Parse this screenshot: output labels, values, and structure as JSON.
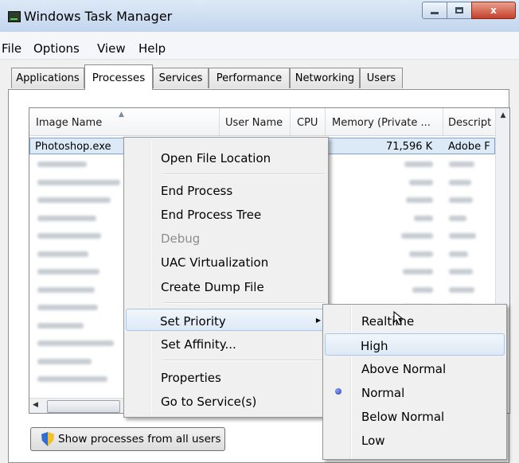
{
  "window": {
    "title": "Windows Task Manager"
  },
  "caption_buttons": {
    "minimize": "minimize-icon",
    "maximize": "maximize-icon",
    "close": "x"
  },
  "menubar": {
    "items": [
      "File",
      "Options",
      "View",
      "Help"
    ]
  },
  "tabs": [
    "Applications",
    "Processes",
    "Services",
    "Performance",
    "Networking",
    "Users"
  ],
  "active_tab": "Processes",
  "process_table": {
    "columns": [
      "Image Name",
      "User Name",
      "CPU",
      "Memory (Private ...",
      "Descript"
    ],
    "selected_row": {
      "image_name": "Photoshop.exe",
      "memory": "71,596 K",
      "description": "Adobe F"
    }
  },
  "show_all_button": {
    "label": "Show processes from all users",
    "icon": "uac-shield-icon"
  },
  "context_menu": {
    "items": [
      "Open File Location",
      "End Process",
      "End Process Tree",
      "Debug",
      "UAC Virtualization",
      "Create Dump File",
      "Set Priority",
      "Set Affinity...",
      "Properties",
      "Go to Service(s)"
    ],
    "disabled": [
      "Debug"
    ],
    "highlighted": "Set Priority"
  },
  "priority_submenu": {
    "items": [
      "Realtime",
      "High",
      "Above Normal",
      "Normal",
      "Below Normal",
      "Low"
    ],
    "checked": "Normal",
    "highlighted": "High"
  },
  "colors": {
    "selection_border": "#7da2ce",
    "selection_fill": "#dceaf8",
    "menu_highlight": "#a8c6ea",
    "close_red": "#c5402b"
  }
}
